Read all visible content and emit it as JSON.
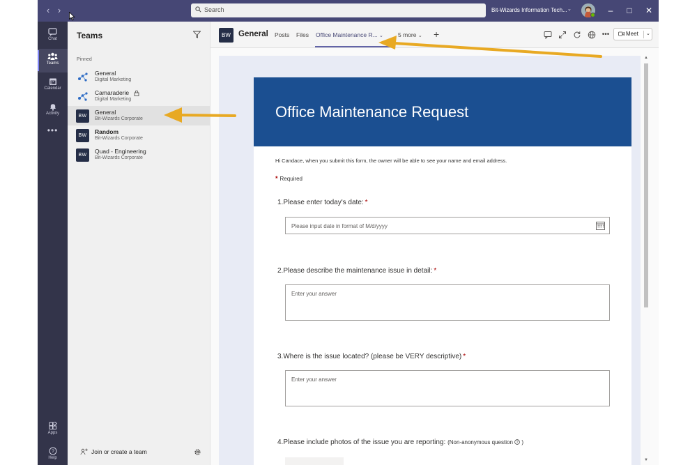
{
  "titlebar": {
    "search_placeholder": "Search",
    "org_name": "Bit-Wizards Information Tech...",
    "back_icon": "chevron-left-icon",
    "forward_icon": "chevron-right-icon"
  },
  "rail": {
    "items": [
      {
        "label": "Chat",
        "icon": "chat-icon"
      },
      {
        "label": "Teams",
        "icon": "teams-icon",
        "active": true
      },
      {
        "label": "Calendar",
        "icon": "calendar-icon"
      },
      {
        "label": "Activity",
        "icon": "bell-icon"
      },
      {
        "label": "...",
        "icon": "more-icon"
      },
      {
        "label": "Apps",
        "icon": "apps-icon"
      },
      {
        "label": "Help",
        "icon": "help-icon"
      }
    ]
  },
  "panel": {
    "title": "Teams",
    "pinned_label": "Pinned",
    "teams": [
      {
        "name": "General",
        "sub": "Digital Marketing"
      },
      {
        "name": "Camaraderie",
        "sub": "Digital Marketing"
      },
      {
        "name": "General",
        "sub": "Bit-Wizards Corporate",
        "selected": true,
        "icon_text": "BW"
      },
      {
        "name": "Random",
        "sub": "Bit-Wizards Corporate",
        "icon_text": "BW"
      },
      {
        "name": "Quad - Engineering",
        "sub": "Bit-Wizards Corporate",
        "icon_text": "BW"
      }
    ],
    "join_label": "Join or create a team"
  },
  "header": {
    "channel_icon_text": "BW",
    "channel_name": "General",
    "tabs": [
      "Posts",
      "Files",
      "Office Maintenance R...",
      "5 more"
    ],
    "meet_label": "Meet"
  },
  "form": {
    "title": "Office Maintenance Request",
    "notice": "Hi Candace, when you submit this form, the owner will be able to see your name and email address.",
    "required_label": "Required",
    "questions": [
      {
        "num": "1.",
        "text": "Please enter today's date:",
        "placeholder": "Please input date in format of M/d/yyyy"
      },
      {
        "num": "2.",
        "text": "Please describe the maintenance issue in detail:",
        "placeholder": "Enter your answer"
      },
      {
        "num": "3.",
        "text": "Where is the issue located? (please be VERY descriptive)",
        "placeholder": "Enter your answer"
      },
      {
        "num": "4.",
        "text": "Please include photos of the issue you are reporting:",
        "note": "(Non-anonymous question",
        "note_end": ")"
      }
    ]
  },
  "colors": {
    "titlebar": "#464775",
    "rail": "#33344a",
    "banner": "#1b4f91",
    "accent": "#6264a7",
    "arrow": "#e8a923",
    "required": "#a80000"
  }
}
